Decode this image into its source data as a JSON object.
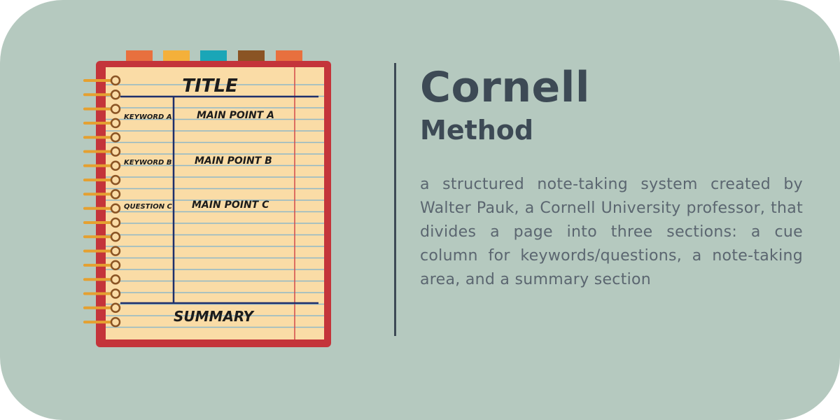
{
  "heading": {
    "title": "Cornell",
    "subtitle": "Method"
  },
  "description": "a structured note-taking system created by Walter Pauk, a Cornell University professor, that divides a page into three sections: a cue column for keywords/questions, a note-taking area, and a summary section",
  "notebook": {
    "title": "TITLE",
    "summary": "SUMMARY",
    "cues": [
      "KEYWORD A",
      "KEYWORD B",
      "QUESTION C"
    ],
    "points": [
      "MAIN POINT A",
      "MAIN POINT B",
      "MAIN POINT C"
    ],
    "tabs": [
      "tab-orange",
      "tab-yellow",
      "tab-teal",
      "tab-brown",
      "tab-orange"
    ]
  },
  "colors": {
    "background": "#b5c9bf",
    "text_dark": "#3d4a55",
    "text_body": "#5b6670",
    "cover": "#c4343a",
    "paper": "#fadca6",
    "ruled_line": "#8fb8c7",
    "margin_line": "#d14a4a",
    "section_line": "#1f2f6b",
    "spiral": "#e5a030",
    "tab_colors": [
      "#e8703e",
      "#f4b03a",
      "#1aa6b7",
      "#8a5424",
      "#e8703e"
    ]
  }
}
